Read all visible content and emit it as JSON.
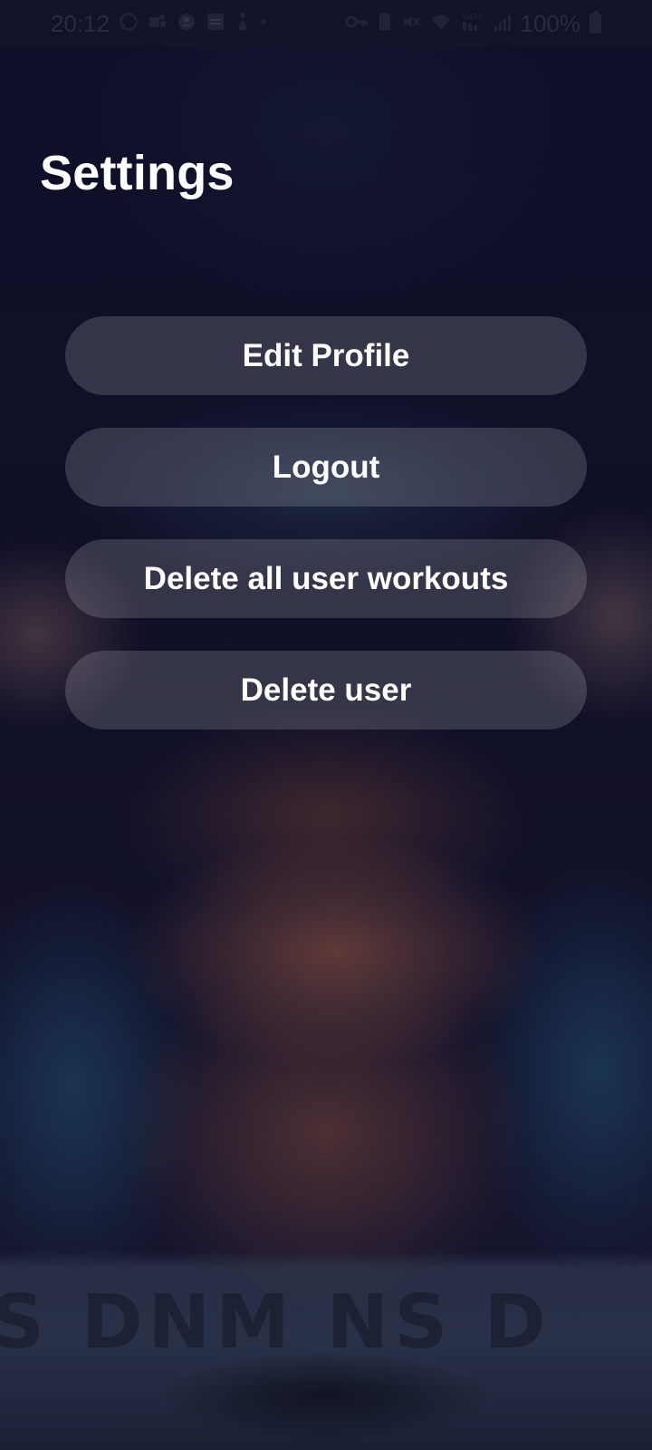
{
  "status_bar": {
    "time": "20:12",
    "battery_percent": "100%",
    "left_icons": [
      "whatsapp-icon",
      "teams-icon",
      "account-icon",
      "calendar-icon",
      "fitness-icon",
      "dot-icon"
    ],
    "right_icons": [
      "vpn-key-icon",
      "sim-icon",
      "mute-vibrate-icon",
      "wifi-icon",
      "volte-signal-icon",
      "signal-icon",
      "battery-icon"
    ]
  },
  "page": {
    "title": "Settings"
  },
  "menu": {
    "items": [
      {
        "label": "Edit Profile"
      },
      {
        "label": "Logout"
      },
      {
        "label": "Delete all user workouts"
      },
      {
        "label": "Delete user"
      }
    ]
  },
  "background": {
    "waistband_text": "S DNM NS D"
  },
  "colors": {
    "background": "#0f0f26",
    "button_fill": "rgba(255,255,255,0.16)",
    "text": "#ffffff"
  }
}
